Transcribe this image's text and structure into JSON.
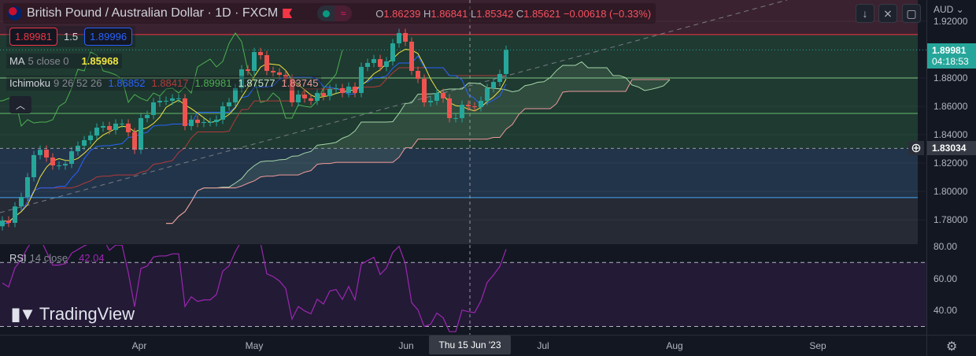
{
  "header": {
    "title": "British Pound / Australian Dollar · 1D · FXCM",
    "ohlc": {
      "o_label": "O",
      "o": "1.86239",
      "h_label": "H",
      "h": "1.86841",
      "l_label": "L",
      "l": "1.85342",
      "c_label": "C",
      "c": "1.85621",
      "change": "−0.00618 (−0.33%)"
    },
    "pill_icon": "≈"
  },
  "trade": {
    "sell": "1.89981",
    "spread": "1.5",
    "buy": "1.89996"
  },
  "ma": {
    "label": "MA",
    "params": "5 close 0",
    "value": "1.85968"
  },
  "ichimoku": {
    "label": "Ichimoku",
    "params": "9 26 52 26",
    "v1": "1.86852",
    "v2": "1.88417",
    "v3": "1.89981",
    "v4": "1.87577",
    "v5": "1.83745"
  },
  "rsi": {
    "label": "RSI",
    "params": "14 close",
    "value": "42.04"
  },
  "axis": {
    "currency": "AUD ⌄",
    "last_price": "1.89981",
    "countdown": "04:18:53",
    "crosshair_price": "1.83034",
    "crosshair_date": "Thu 15 Jun '23"
  },
  "time_labels": [
    "Apr",
    "May",
    "Jun",
    "Jul",
    "Aug",
    "Sep"
  ],
  "logo": "TradingView",
  "colors": {
    "up": "#26a69a",
    "down": "#ef5350",
    "ma": "#f0e442",
    "conversion": "#2962ff",
    "base": "#b23a3a",
    "lagging": "#4caf50",
    "spanA": "#a5d6a7",
    "spanB": "#ef9a9a",
    "rsi": "#9c27b0"
  },
  "chart_data": {
    "type": "candlestick",
    "symbol": "GBPAUD",
    "interval": "1D",
    "closes": [
      1.7794,
      1.7778,
      1.7894,
      1.7961,
      1.81,
      1.8256,
      1.8294,
      1.8239,
      1.8183,
      1.8183,
      1.8194,
      1.8283,
      1.8322,
      1.8361,
      1.8394,
      1.845,
      1.8461,
      1.8433,
      1.8478,
      1.8478,
      1.8417,
      1.8294,
      1.8517,
      1.8539,
      1.8628,
      1.8639,
      1.8639,
      1.8656,
      1.8656,
      1.8461,
      1.8506,
      1.8483,
      1.8489,
      1.8489,
      1.8506,
      1.86,
      1.8628,
      1.8728,
      1.8861,
      1.885,
      1.8983,
      1.8961,
      1.885,
      1.8839,
      1.8822,
      1.8794,
      1.8628,
      1.8683,
      1.8656,
      1.8639,
      1.8694,
      1.8672,
      1.8722,
      1.8728,
      1.8694,
      1.8739,
      1.8694,
      1.8878,
      1.8906,
      1.8933,
      1.8878,
      1.8917,
      1.9044,
      1.9117,
      1.9056,
      1.885,
      1.8794,
      1.8628,
      1.8639,
      1.8694,
      1.8656,
      1.8517,
      1.8517,
      1.8611,
      1.86,
      1.8594,
      1.8639,
      1.8728,
      1.8772,
      1.8828,
      1.8998
    ],
    "price_ticks": [
      1.92,
      1.88,
      1.86,
      1.84,
      1.82,
      1.8,
      1.78
    ],
    "price_tick_labels": [
      "1.92000",
      "1.88000",
      "1.86000",
      "1.84000",
      "1.82000",
      "1.80000",
      "1.78000"
    ],
    "rsi_ticks": [
      80,
      60,
      40
    ],
    "rsi_tick_labels": [
      "80.00",
      "60.00",
      "40.00"
    ],
    "levels": {
      "stop": 1.9106,
      "target_a": 1.88,
      "target_b": 1.855,
      "entry": 1.83034,
      "lower": 1.7956,
      "last": 1.89981
    },
    "ylim": [
      1.7625,
      1.9347
    ]
  }
}
